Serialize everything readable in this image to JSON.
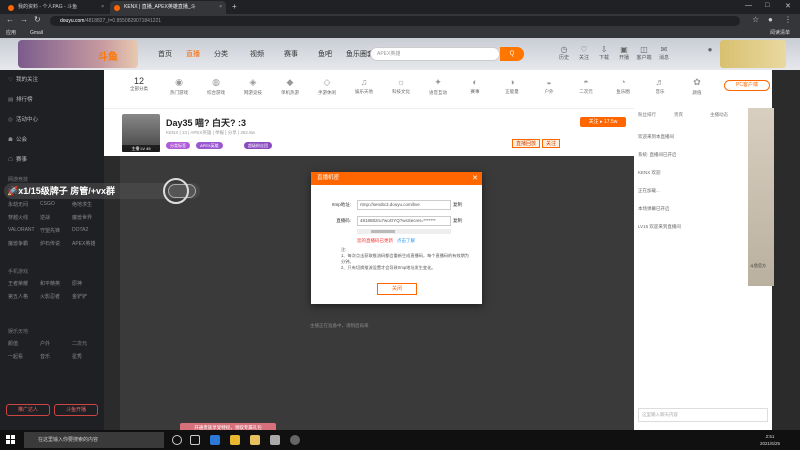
{
  "browser": {
    "tabs": [
      {
        "title": "我的资料 - 个人PAG - 斗鱼"
      },
      {
        "title": "KENX | 直播_APEX英雄直播_斗"
      }
    ],
    "url_host": "douyu.com",
    "url_rest": "/4818827_t=0.8550829071841221",
    "bookmarks": [
      {
        "label": "应用"
      },
      {
        "label": "Gmail"
      }
    ],
    "bookmarks_right": "阅读清单"
  },
  "header": {
    "nav": [
      {
        "label": "首页"
      },
      {
        "label": "直播"
      },
      {
        "label": "分类"
      },
      {
        "label": "视频"
      },
      {
        "label": "赛事"
      },
      {
        "label": "鱼吧"
      },
      {
        "label": "鱼乐圈套"
      }
    ],
    "search_placeholder": "APEX英雄",
    "search_button": "Q",
    "icons": [
      {
        "label": "历史",
        "glyph": "◷"
      },
      {
        "label": "关注",
        "glyph": "♡"
      },
      {
        "label": "下载",
        "glyph": "⇩"
      },
      {
        "label": "开播",
        "glyph": "▣"
      },
      {
        "label": "客户端",
        "glyph": "◫"
      },
      {
        "label": "消息",
        "glyph": "✉"
      },
      {
        "label": "任务",
        "glyph": "☷"
      }
    ]
  },
  "sidebar": {
    "items": [
      {
        "icon": "♡",
        "label": "我的关注"
      },
      {
        "icon": "▤",
        "label": "排行榜"
      },
      {
        "icon": "◎",
        "label": "活动中心"
      },
      {
        "icon": "☗",
        "label": "公会"
      },
      {
        "icon": "☖",
        "label": "赛事"
      }
    ],
    "section_hot": "网游竞技",
    "hot_games": [
      "英雄联盟",
      "DNF",
      "CF",
      "永劫无间",
      "CSGO",
      "绝地求生",
      "穿越火线",
      "逆战",
      "魔兽世界",
      "VALORANT",
      "守望先锋",
      "DOTA2",
      "魔兽争霸",
      "炉石传说",
      "APEX英雄"
    ],
    "section_mobile": "手机游戏",
    "mobile_games": [
      "王者荣耀",
      "和平精英",
      "原神",
      "第五人格",
      "火影忍者",
      "金铲铲"
    ],
    "section_fun": "娱乐天地",
    "fun": [
      "颜值",
      "户外",
      "二次元",
      "一起看",
      "音乐",
      "星秀"
    ],
    "btn_left": "推广达人",
    "btn_right": "斗鱼开播"
  },
  "categories": {
    "count": "12",
    "count_label": "全部分类",
    "items": [
      {
        "label": "热门游戏"
      },
      {
        "label": "综合游戏"
      },
      {
        "label": "网游竞技"
      },
      {
        "label": "单机热游"
      },
      {
        "label": "手游休闲"
      },
      {
        "label": "娱乐天地"
      },
      {
        "label": "科技文化"
      },
      {
        "label": "语音互动"
      },
      {
        "label": "赛事"
      },
      {
        "label": "正能量"
      },
      {
        "label": "户外"
      },
      {
        "label": "二次元"
      },
      {
        "label": "鱼乐圈"
      },
      {
        "label": "音乐"
      },
      {
        "label": "颜值"
      }
    ],
    "pc_app": "PC客户端"
  },
  "room": {
    "avatar_level": "主播 LV 45",
    "title": "Day35 喵? 白天? :3",
    "subtitle": "KENX  |  13  |  APEX英雄  |  举报  |  分享  |  282.8w",
    "tags": [
      {
        "label": "分类标签"
      },
      {
        "label": "APEX英雄"
      },
      {
        "label": "超级粉丝团"
      }
    ],
    "actions": [
      {
        "label": "直播回放"
      },
      {
        "label": "关注"
      }
    ],
    "follow": "关注 ▸ 17.5w"
  },
  "video": {
    "message": "主播正在准备中，请稍后再来",
    "bottom_tip": "开通贵族享受特权，领取专属礼包"
  },
  "overlay_text": "🚀x1/15级牌子 房管/+vx群",
  "modal": {
    "title": "直播机密",
    "close": "✕",
    "rtmp_label": "rtmp地址:",
    "rtmp_value": "rtmp://sendtc3.douyu.com/live",
    "code_label": "直播码:",
    "code_value": "4818882ru7woOYQ?wsSecret=*******",
    "copy1": "复制",
    "copy2": "复制",
    "warn": "您的直播码已更新",
    "warn_link": "点击了解",
    "notes": "注:\n1、每次点击获取推流码都会重新生成直播码，每个直播码的有效期为分钟。\n2、只有切换推流设置才会导致rtmp地址发生变化。",
    "ok": "关闭"
  },
  "chat": {
    "tabs": [
      {
        "label": "粉丝排行"
      },
      {
        "label": "贵宾"
      },
      {
        "label": "主播动态"
      }
    ],
    "lines": [
      "欢迎来到本直播间",
      "系统: 直播间已开启",
      "KENX 欢迎",
      "正在加载...",
      "本场弹幕已开启",
      "LV15 欢迎来到直播间"
    ],
    "input_placeholder": "这里输入聊天内容"
  },
  "right_ad": "斗鱼官方",
  "taskbar": {
    "search_placeholder": "在这里输入你要搜索的内容",
    "time": "2:51",
    "date": "2021/6/25"
  },
  "colors": {
    "accent": "#ff6600",
    "link": "#2299ff",
    "warn": "#ee3333"
  }
}
